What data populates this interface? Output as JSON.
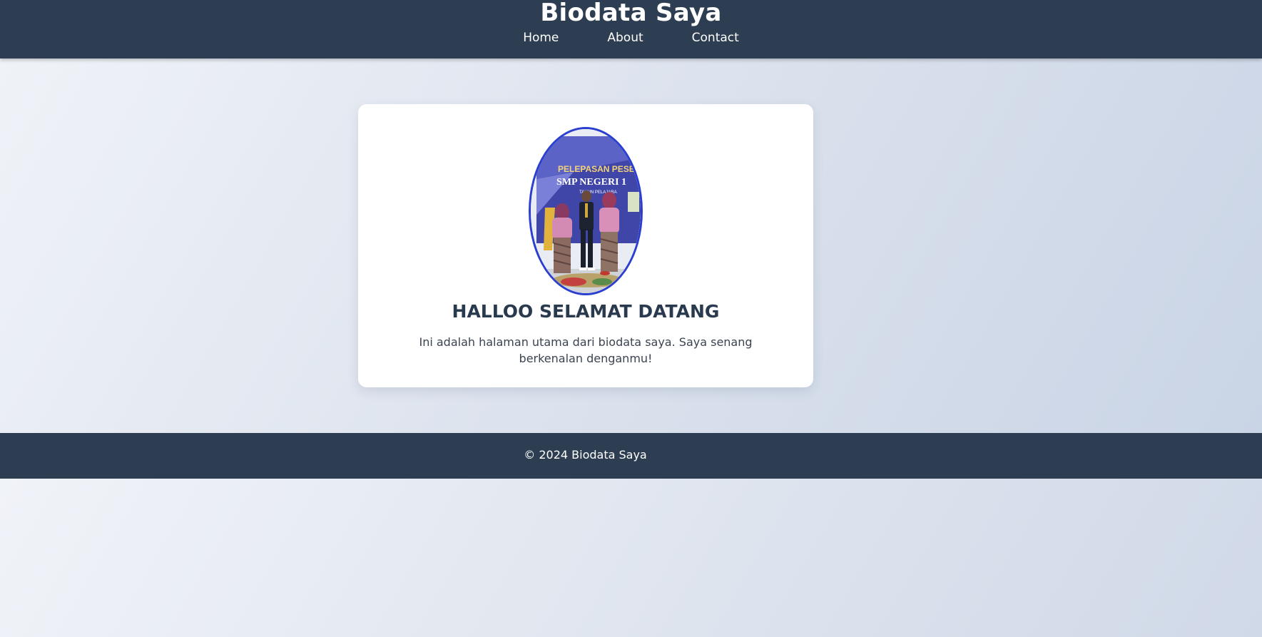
{
  "header": {
    "title": "Biodata Saya",
    "nav": {
      "home": "Home",
      "about": "About",
      "contact": "Contact"
    }
  },
  "main": {
    "heading": "HALLOO SELAMAT DATANG",
    "intro": "Ini adalah halaman utama dari biodata saya. Saya senang berkenalan denganmu!",
    "photo": {
      "banner_line1": "PELEPASAN PESER",
      "banner_line2": "SMP NEGERI 1",
      "banner_line3": "TAHUN PELAJARA"
    }
  },
  "footer": {
    "copyright": "© 2024 Biodata Saya"
  },
  "colors": {
    "header_bg": "#2e3e52",
    "avatar_border": "#2a3fd0",
    "heading_text": "#2a3a4e"
  }
}
